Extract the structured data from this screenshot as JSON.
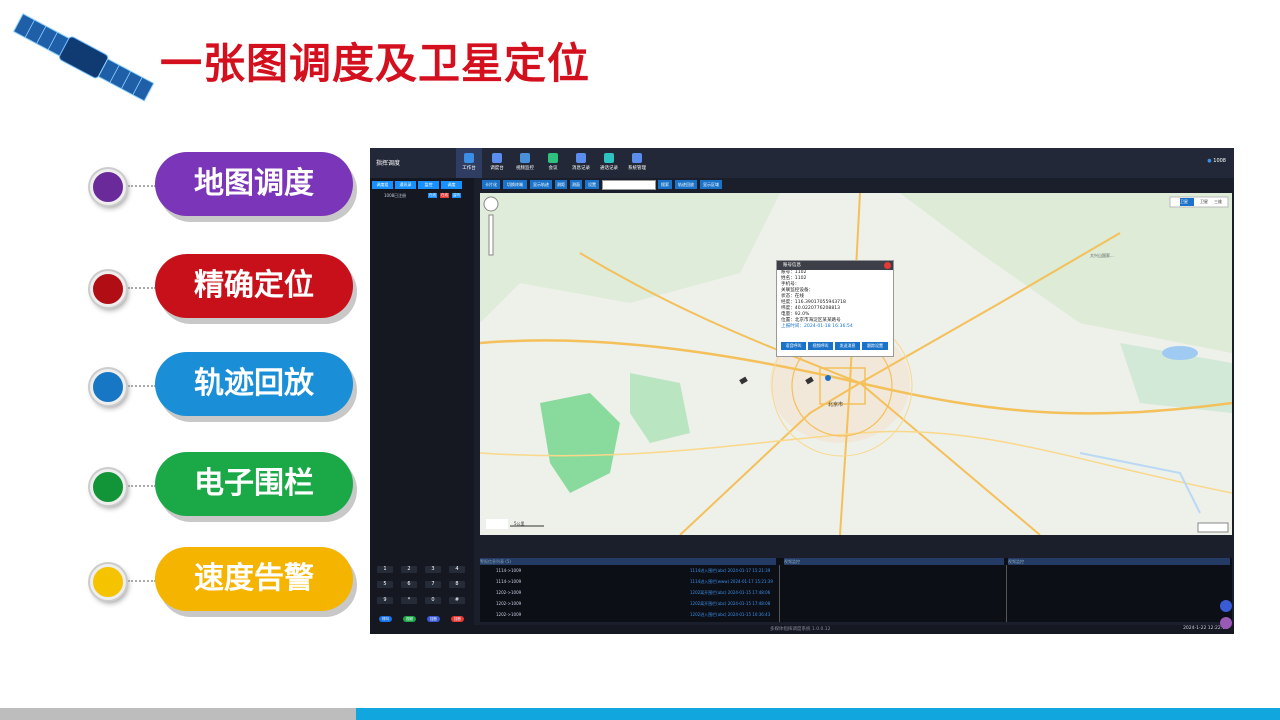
{
  "slide": {
    "title": "一张图调度及卫星定位",
    "features": [
      {
        "label": "地图调度",
        "color": "#7b35b8",
        "dot": "#6a2a9a"
      },
      {
        "label": "精确定位",
        "color": "#c8101a",
        "dot": "#b00d15"
      },
      {
        "label": "轨迹回放",
        "color": "#1a8ed6",
        "dot": "#1777c4"
      },
      {
        "label": "电子围栏",
        "color": "#1ba948",
        "dot": "#129538"
      },
      {
        "label": "速度告警",
        "color": "#f5b400",
        "dot": "#f5c300"
      }
    ]
  },
  "app": {
    "logo": "指挥调度",
    "nav": [
      {
        "label": "工作台",
        "color": "#3a8ee6"
      },
      {
        "label": "调度台",
        "color": "#5b8def"
      },
      {
        "label": "视频监控",
        "color": "#4a90d9"
      },
      {
        "label": "会议",
        "color": "#2ec27e"
      },
      {
        "label": "消息记录",
        "color": "#5b8def"
      },
      {
        "label": "通话记录",
        "color": "#2ec2c2"
      },
      {
        "label": "系统管理",
        "color": "#5b8def"
      }
    ],
    "user": "1008",
    "left_tabs": [
      "调度组",
      "通讯录",
      "监控",
      "调度"
    ],
    "left_item": "1008已注册",
    "left_item_badges": [
      "在线",
      "在线",
      "监听"
    ],
    "dial_keys": [
      "1",
      "2",
      "3",
      "4",
      "5",
      "6",
      "7",
      "8",
      "9",
      "*",
      "0",
      "#"
    ],
    "call_buttons": [
      {
        "label": "呼叫",
        "color": "#1a73e8"
      },
      {
        "label": "视频",
        "color": "#1ba948"
      },
      {
        "label": "挂断",
        "color": "#3a5bd6"
      },
      {
        "label": "挂断",
        "color": "#e53935"
      }
    ],
    "map_tools": [
      "卡片化",
      "切换终端",
      "显示轨迹",
      "测距",
      "测面",
      "设置",
      "搜索",
      "轨迹回放",
      "显示区域"
    ],
    "map_layers": [
      "卫星",
      "卫星",
      "三维"
    ],
    "map_place": "北京市",
    "map_place_2": "大兴山国家...",
    "popup": {
      "title": "账号信息",
      "rows": [
        "账号：1102",
        "姓名：1102",
        "手机号：",
        "关联监控设备：",
        "状态：在线",
        "经度：116.39017055943718",
        "纬度：40.0220776208813",
        "电量：92.0%",
        "位置：北京市海淀区某某路号"
      ],
      "time_label": "上报时间：",
      "time": "2024-01-18 16:36:54",
      "buttons": [
        "语音呼叫",
        "视频呼叫",
        "发送消息",
        "跟踪设置"
      ]
    },
    "bottom_headers": [
      "警报信息列表 (5)",
      "视频监控",
      "视频监控"
    ],
    "bottom_rows": [
      {
        "a": "1114->1009",
        "b": "1114进入围栏(abc) 2024-01-17 15:21:39"
      },
      {
        "a": "1114->1009",
        "b": "1114进入围栏(www) 2024-01-17 15:21:39"
      },
      {
        "a": "1202->1009",
        "b": "1202离开围栏(abc) 2024-01-15 17:48:06"
      },
      {
        "a": "1202->1009",
        "b": "1202离开围栏(abc) 2024-01-15 17:48:08"
      },
      {
        "a": "1202->1009",
        "b": "1202进入围栏(abc) 2024-01-15 10:36:43"
      }
    ],
    "footer_center": "多媒体指挥调度系统 1.0.0.12",
    "footer_right": "2024-1-22 12:22:11",
    "scale": "5公里"
  }
}
